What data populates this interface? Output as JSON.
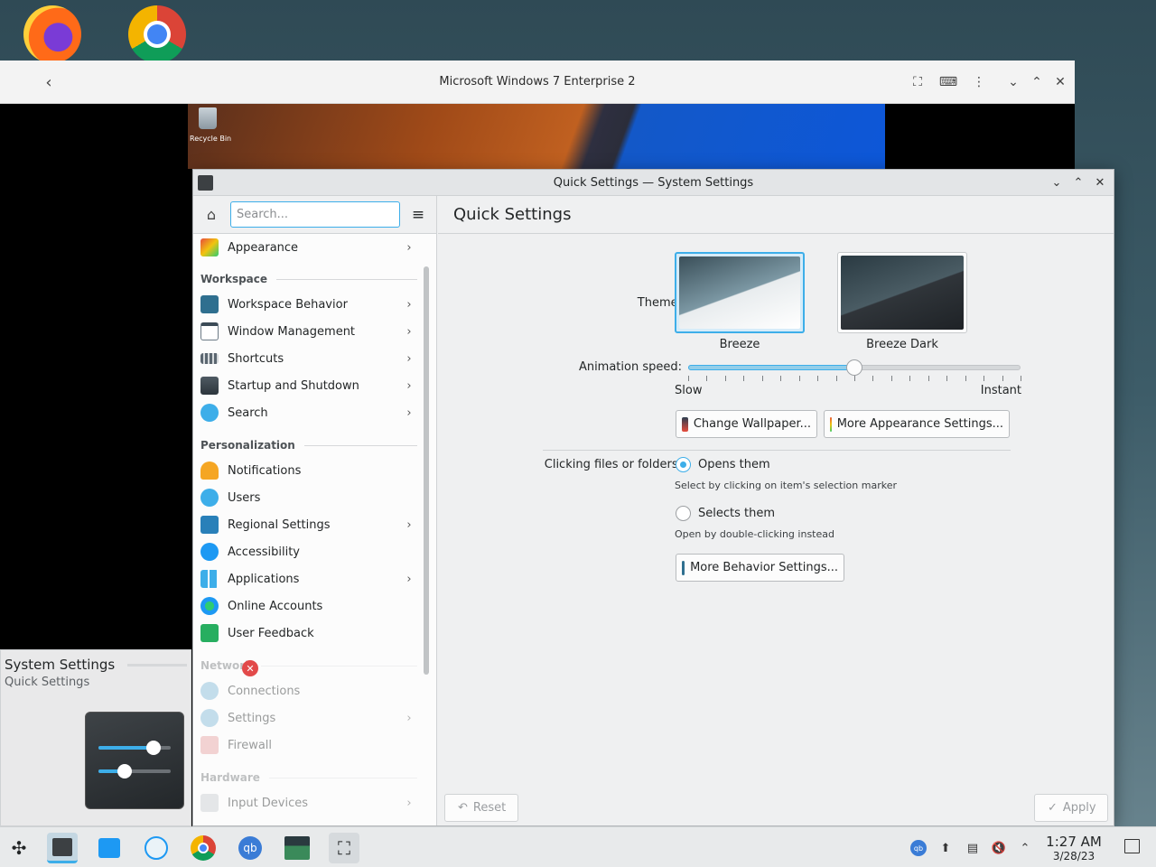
{
  "vm_window": {
    "title": "Microsoft Windows 7 Enterprise 2",
    "guest_desktop_icon": "Recycle Bin"
  },
  "settings_window": {
    "title": "Quick Settings — System Settings",
    "search_placeholder": "Search...",
    "page_title": "Quick Settings",
    "sidebar": {
      "top_item": "Appearance",
      "categories": {
        "workspace": "Workspace",
        "personalization": "Personalization",
        "network": "Network",
        "hardware": "Hardware"
      },
      "workspace_items": [
        "Workspace Behavior",
        "Window Management",
        "Shortcuts",
        "Startup and Shutdown",
        "Search"
      ],
      "personalization_items": [
        "Notifications",
        "Users",
        "Regional Settings",
        "Accessibility",
        "Applications",
        "Online Accounts",
        "User Feedback"
      ],
      "network_items": [
        "Connections",
        "Settings",
        "Firewall"
      ],
      "hardware_items": [
        "Input Devices"
      ]
    },
    "theme": {
      "label": "Theme:",
      "options": [
        "Breeze",
        "Breeze Dark"
      ],
      "selected": "Breeze"
    },
    "animation": {
      "label": "Animation speed:",
      "min_label": "Slow",
      "max_label": "Instant",
      "value_fraction": 0.5
    },
    "buttons": {
      "change_wallpaper": "Change Wallpaper...",
      "more_appearance": "More Appearance Settings...",
      "more_behavior": "More Behavior Settings...",
      "reset": "Reset",
      "apply": "Apply"
    },
    "clicking": {
      "label": "Clicking files or folders:",
      "opens_label": "Opens them",
      "opens_desc": "Select by clicking on item's selection marker",
      "selects_label": "Selects them",
      "selects_desc": "Open by double-clicking instead",
      "selected": "Opens them"
    }
  },
  "tooltip": {
    "title": "System Settings",
    "subtitle": "Quick Settings"
  },
  "taskbar": {
    "time": "1:27 AM",
    "date": "3/28/23"
  },
  "colors": {
    "accent": "#3daee9",
    "window_bg": "#eff0f1",
    "close_badge": "#e24a4a"
  }
}
